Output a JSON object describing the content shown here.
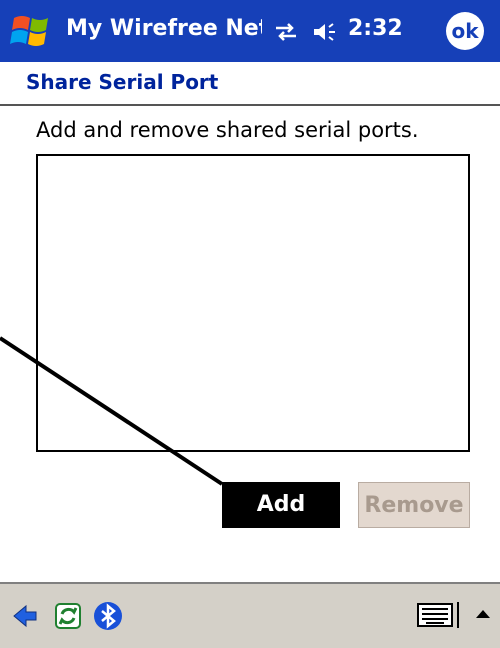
{
  "titlebar": {
    "app_title": "My Wirefree Networ",
    "clock": "2:32",
    "ok_label": "ok",
    "icons": [
      "windows-start-icon",
      "connectivity-icon",
      "volume-icon"
    ]
  },
  "page": {
    "title": "Share Serial Port",
    "instruction": "Add and remove shared serial ports."
  },
  "port_list": {
    "items": []
  },
  "buttons": {
    "add_label": "Add",
    "remove_label": "Remove"
  },
  "bottombar": {
    "icons": [
      "back-arrow-icon",
      "sync-icon",
      "bluetooth-icon",
      "keyboard-icon",
      "sip-arrow-icon"
    ]
  },
  "colors": {
    "titlebar": "#1640b8",
    "page_title": "#00249c",
    "disabled_button": "#e3d8cf"
  }
}
